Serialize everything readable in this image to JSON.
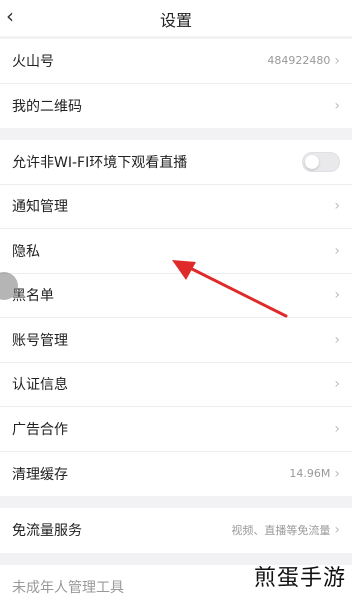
{
  "nav": {
    "back_icon": "chevron-left-icon",
    "title": "设置"
  },
  "group1": {
    "huoshan_label": "火山号",
    "huoshan_value": "484922480",
    "qrcode_label": "我的二维码"
  },
  "group2": {
    "wifi_label": "允许非WI-FI环境下观看直播",
    "wifi_toggle_on": false,
    "notify_label": "通知管理",
    "privacy_label": "隐私",
    "blacklist_label": "黑名单",
    "account_label": "账号管理",
    "verify_label": "认证信息",
    "ads_label": "广告合作",
    "cache_label": "清理缓存",
    "cache_value": "14.96M"
  },
  "group3": {
    "freeflow_label": "免流量服务",
    "freeflow_value": "视频、直播等免流量"
  },
  "group4": {
    "minor_label": "未成年人管理工具"
  },
  "overlay": {
    "watermark": "煎蛋手游",
    "arrow_color": "#e02a2a"
  }
}
